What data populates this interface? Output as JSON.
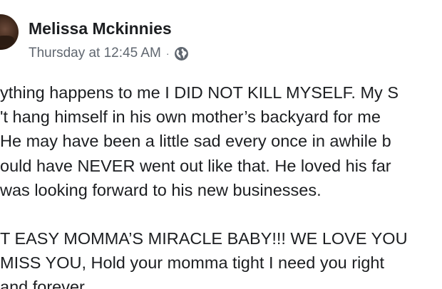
{
  "post": {
    "author": "Melissa Mckinnies",
    "timestamp": "Thursday at 12:45 AM",
    "separator": "·",
    "privacy_icon": "globe-icon",
    "lines": [
      "ything happens to me I DID NOT KILL MYSELF. My S",
      "'t hang himself in his own mother’s backyard for me",
      "He may have been a little sad every once in awhile b",
      "ould have NEVER went out like that. He loved his far",
      "was looking forward to his new businesses.",
      "T EASY MOMMA’S MIRACLE BABY!!! WE LOVE YOU",
      "MISS YOU, Hold your momma tight I need you right",
      "and forever."
    ]
  },
  "colors": {
    "text": "#1c1e21",
    "meta": "#606770",
    "background": "#ffffff"
  }
}
